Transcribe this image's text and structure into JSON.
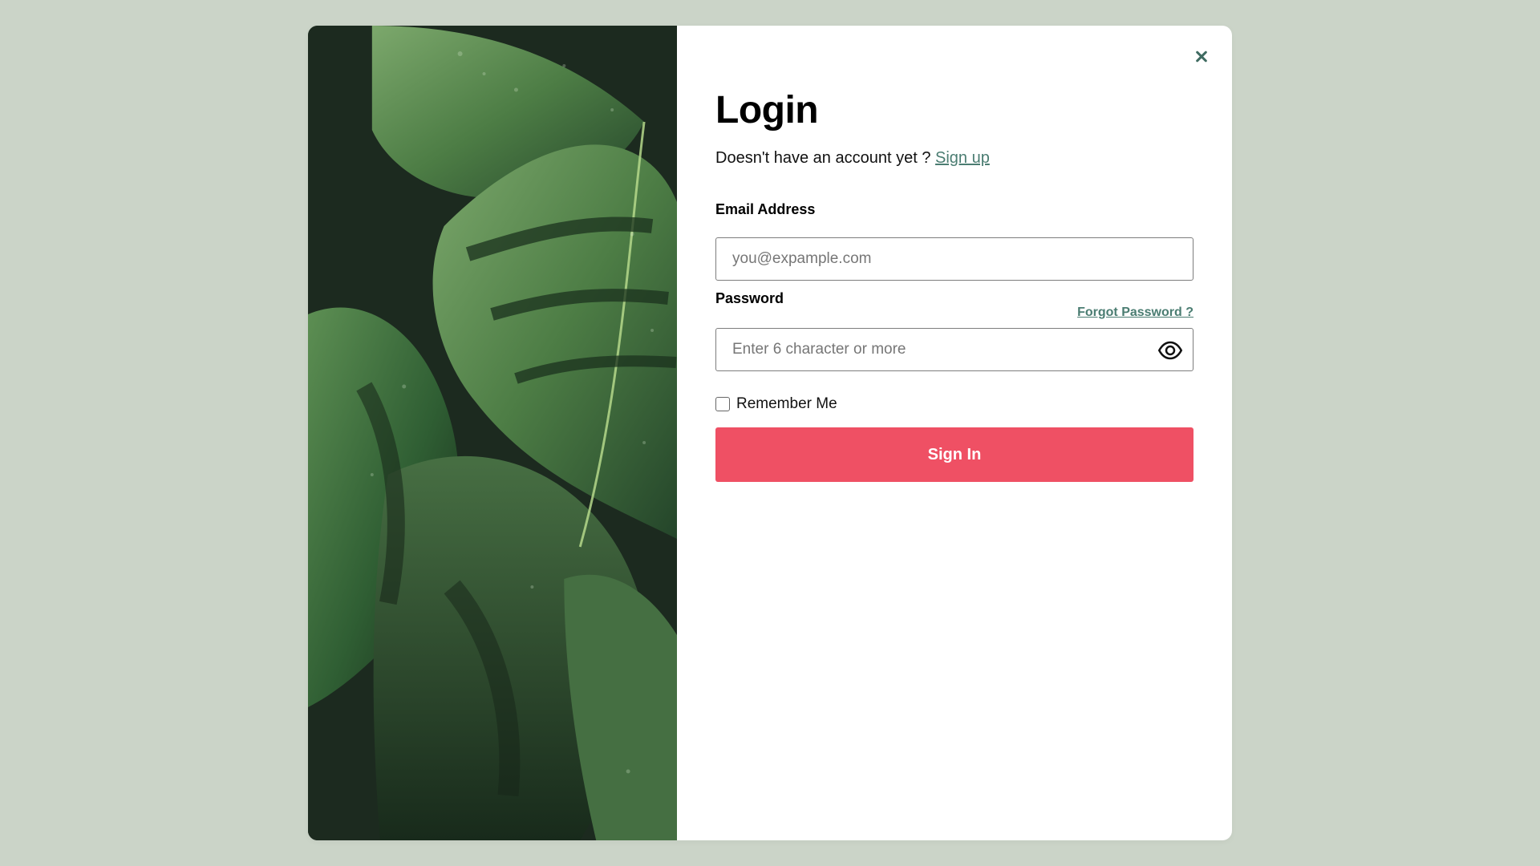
{
  "modal": {
    "title": "Login",
    "signup_prompt": "Doesn't have an account yet ?",
    "signup_link": "Sign up",
    "email_label": "Email Address",
    "email_placeholder": "you@expample.com",
    "password_label": "Password",
    "forgot_password": "Forgot Password ?",
    "password_placeholder": "Enter 6 character or more",
    "remember_label": "Remember Me",
    "signin_label": "Sign In"
  },
  "icons": {
    "close": "close-icon",
    "eye": "eye-icon",
    "checkbox": "checkbox"
  },
  "colors": {
    "background": "#cbd4c8",
    "modal": "#ffffff",
    "accent": "#4b7d72",
    "button": "#ef5064",
    "text": "#111111"
  }
}
